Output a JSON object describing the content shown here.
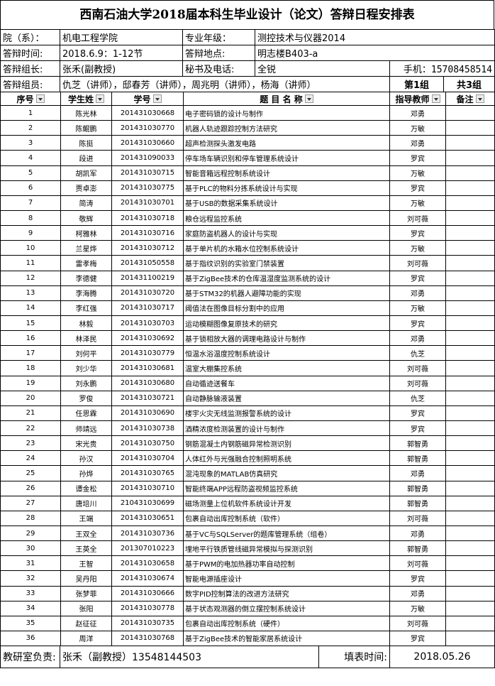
{
  "title": "西南石油大学2018届本科生毕业设计（论文）答辩日程安排表",
  "info": {
    "dept_label": "院（系）：",
    "dept_value": "机电工程学院",
    "major_label": "专业年级：",
    "major_value": "测控技术与仪器2014",
    "time_label": "答辩时间:",
    "time_value": "2018.6.9：1-12节",
    "place_label": "答辩地点:",
    "place_value": "明志楼B403-a",
    "leader_label": "答辩组长:",
    "leader_value": "张禾(副教授)",
    "secretary_label": "秘书及电话:",
    "secretary_value": "全锐",
    "phone_label": "手机：",
    "phone_value": "15708458514",
    "members_label": "答辩组员:",
    "members_value": "仇芝（讲师），邸春芳（讲师），周兆明（讲师），杨海（讲师）",
    "group_label": "第1组",
    "total_label": "共3组"
  },
  "columns": [
    "序号",
    "学生姓",
    "学号",
    "题 目 名 称",
    "指导教师",
    "备注"
  ],
  "rows": [
    [
      "1",
      "陈光林",
      "201431030668",
      "电子密码锁的设计与制作",
      "邓勇",
      ""
    ],
    [
      "2",
      "陈鲲鹏",
      "201431030770",
      "机器人轨迹跟踪控制方法研究",
      "万敏",
      ""
    ],
    [
      "3",
      "陈挺",
      "201431030660",
      "超声检测探头激发电路",
      "邓勇",
      ""
    ],
    [
      "4",
      "段进",
      "201431090033",
      "停车场车辆识别和停车管理系统设计",
      "罗宾",
      ""
    ],
    [
      "5",
      "胡凯军",
      "201431030715",
      "智能音箱远程控制系统设计",
      "万敏",
      ""
    ],
    [
      "6",
      "贾卓澎",
      "201431030775",
      "基于PLC的物料分拣系统设计与实现",
      "罗宾",
      ""
    ],
    [
      "7",
      "简涛",
      "201431030701",
      "基于USB的数据采集系统设计",
      "万敏",
      ""
    ],
    [
      "8",
      "敬辉",
      "201431030718",
      "粮仓远程监控系统",
      "刘可薇",
      ""
    ],
    [
      "9",
      "柯雅林",
      "201431030716",
      "家庭防盗机器人的设计与实现",
      "罗宾",
      ""
    ],
    [
      "10",
      "兰星烨",
      "201431030712",
      "基于单片机的水箱水位控制系统设计",
      "万敏",
      ""
    ],
    [
      "11",
      "雷孝梅",
      "201431050558",
      "基于指纹识别的实验室门禁装置",
      "刘可薇",
      ""
    ],
    [
      "12",
      "李德健",
      "201431100219",
      "基于ZigBee技术的仓库温湿度监测系统的设计",
      "罗宾",
      ""
    ],
    [
      "13",
      "李海腾",
      "201431030720",
      "基于STM32的机器人避障功能的实现",
      "邓勇",
      ""
    ],
    [
      "14",
      "李红强",
      "201431030717",
      "阈值法在图像目标分割中的应用",
      "万敏",
      ""
    ],
    [
      "15",
      "林毅",
      "201431030703",
      "运动模糊图像复原技术的研究",
      "罗宾",
      ""
    ],
    [
      "16",
      "林泽民",
      "201431030692",
      "基于锁相放大器的调理电路设计与制作",
      "邓勇",
      ""
    ],
    [
      "17",
      "刘何平",
      "201431030779",
      "恒温水浴温度控制系统设计",
      "仇芝",
      ""
    ],
    [
      "18",
      "刘少华",
      "201431030681",
      "温室大棚集控系统",
      "刘可薇",
      ""
    ],
    [
      "19",
      "刘永鹏",
      "201431030680",
      "自动循迹送餐车",
      "刘可薇",
      ""
    ],
    [
      "20",
      "罗俊",
      "201431030721",
      "自动静脉输液装置",
      "仇芝",
      ""
    ],
    [
      "21",
      "任思霖",
      "201431030690",
      "楼宇火灾无线监测报警系统的设计",
      "罗宾",
      ""
    ],
    [
      "22",
      "师靖远",
      "201431030738",
      "酒精浓度检测装置的设计与制作",
      "罗宾",
      ""
    ],
    [
      "23",
      "宋光贵",
      "201431030750",
      "钢筋混凝土内钢筋磁异常检测识别",
      "郭智勇",
      ""
    ],
    [
      "24",
      "孙汉",
      "201431030704",
      "人体红外与光强融合控制照明系统",
      "郭智勇",
      ""
    ],
    [
      "25",
      "孙烨",
      "201431030765",
      "混沌现象的MATLAB仿真研究",
      "邓勇",
      ""
    ],
    [
      "26",
      "谭金松",
      "201431030710",
      "智能终端APP远程防盗视频监控系统",
      "郭智勇",
      ""
    ],
    [
      "27",
      "唐培川",
      "210431030699",
      "磁场测量上位机软件系统设计开发",
      "郭智勇",
      ""
    ],
    [
      "28",
      "王端",
      "201431030651",
      "包裹自动出库控制系统（软件）",
      "刘可薇",
      ""
    ],
    [
      "29",
      "王双全",
      "201431030736",
      "基于VC与SQLServer的题库管理系统（组卷）",
      "邓勇",
      ""
    ],
    [
      "30",
      "王英全",
      "201307010223",
      "埋地平行铁质管线磁异常模拟与探测识别",
      "郭智勇",
      ""
    ],
    [
      "31",
      "王智",
      "201431030658",
      "基于PWM的电加热器功率自动控制",
      "刘可薇",
      ""
    ],
    [
      "32",
      "吴丹阳",
      "201431030674",
      "智能电源插座设计",
      "罗宾",
      ""
    ],
    [
      "33",
      "张梦菲",
      "201431030666",
      "数字PID控制算法的改进方法研究",
      "邓勇",
      ""
    ],
    [
      "34",
      "张阳",
      "201431030778",
      "基于状态观测器的倒立摆控制系统设计",
      "万敏",
      ""
    ],
    [
      "35",
      "赵征征",
      "201431030735",
      "包裹自动出库控制系统（硬件）",
      "刘可薇",
      ""
    ],
    [
      "36",
      "周洋",
      "201431030768",
      "基于ZigBee技术的智能家居系统设计",
      "罗宾",
      ""
    ]
  ],
  "footer": {
    "office_label": "教研室负责:",
    "office_value": "张禾（副教授）13548144503",
    "date_label": "填表时间:",
    "date_value": "2018.05.26"
  }
}
